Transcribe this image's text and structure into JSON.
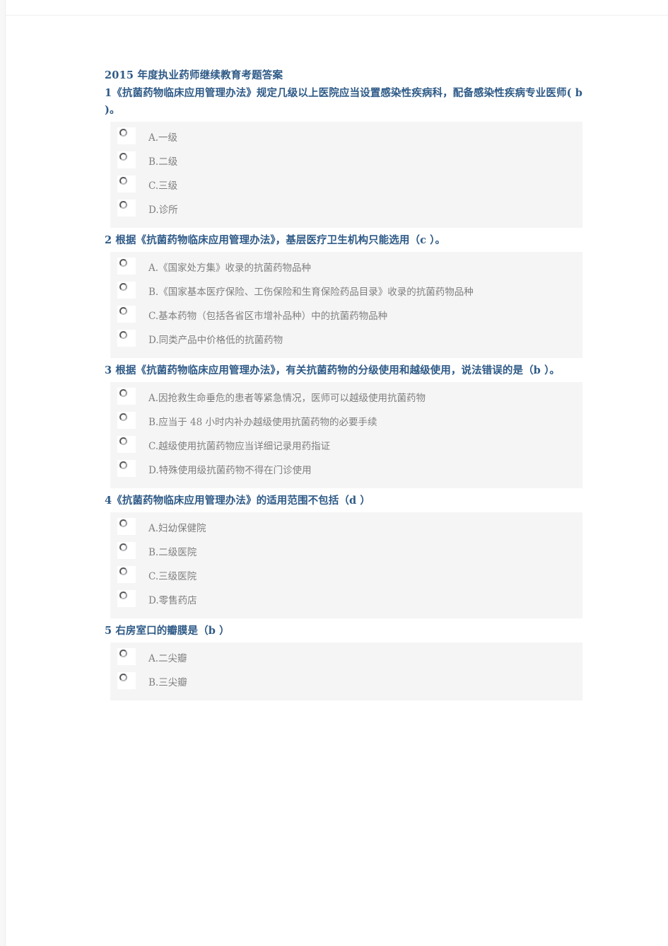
{
  "document": {
    "title": "2015 年度执业药师继续教育考题答案",
    "radio_icon": "radio-unselected-icon"
  },
  "questions": [
    {
      "number": "1",
      "text": "1《抗菌药物临床应用管理办法》规定几级以上医院应当设置感染性疾病科，配备感染性疾病专业医师(  b )。",
      "answer": "b",
      "options": [
        {
          "label": "A.一级"
        },
        {
          "label": "B.二级"
        },
        {
          "label": "C.三级"
        },
        {
          "label": "D.诊所"
        }
      ]
    },
    {
      "number": "2",
      "text": "2 根据《抗菌药物临床应用管理办法》，基层医疗卫生机构只能选用（c ）。",
      "answer": "c",
      "options": [
        {
          "label": "A.《国家处方集》收录的抗菌药物品种"
        },
        {
          "label": "B.《国家基本医疗保险、工伤保险和生育保险药品目录》收录的抗菌药物品种"
        },
        {
          "label": "C.基本药物（包括各省区市增补品种）中的抗菌药物品种"
        },
        {
          "label": "D.同类产品中价格低的抗菌药物"
        }
      ]
    },
    {
      "number": "3",
      "text": "3 根据《抗菌药物临床应用管理办法》，有关抗菌药物的分级使用和越级使用，说法错误的是（b  ）。",
      "answer": "b",
      "options": [
        {
          "label": "A.因抢救生命垂危的患者等紧急情况，医师可以越级使用抗菌药物"
        },
        {
          "label": "B.应当于 48 小时内补办越级使用抗菌药物的必要手续"
        },
        {
          "label": "C.越级使用抗菌药物应当详细记录用药指证"
        },
        {
          "label": "D.特殊使用级抗菌药物不得在门诊使用"
        }
      ]
    },
    {
      "number": "4",
      "text": "4《抗菌药物临床应用管理办法》的适用范围不包括（d  ）",
      "answer": "d",
      "options": [
        {
          "label": "A.妇幼保健院"
        },
        {
          "label": "B.二级医院"
        },
        {
          "label": "C.三级医院"
        },
        {
          "label": "D.零售药店"
        }
      ]
    },
    {
      "number": "5",
      "text": "5 右房室口的瓣膜是（b  ）",
      "answer": "b",
      "options": [
        {
          "label": "A.二尖瓣"
        },
        {
          "label": "B.三尖瓣"
        }
      ]
    }
  ]
}
